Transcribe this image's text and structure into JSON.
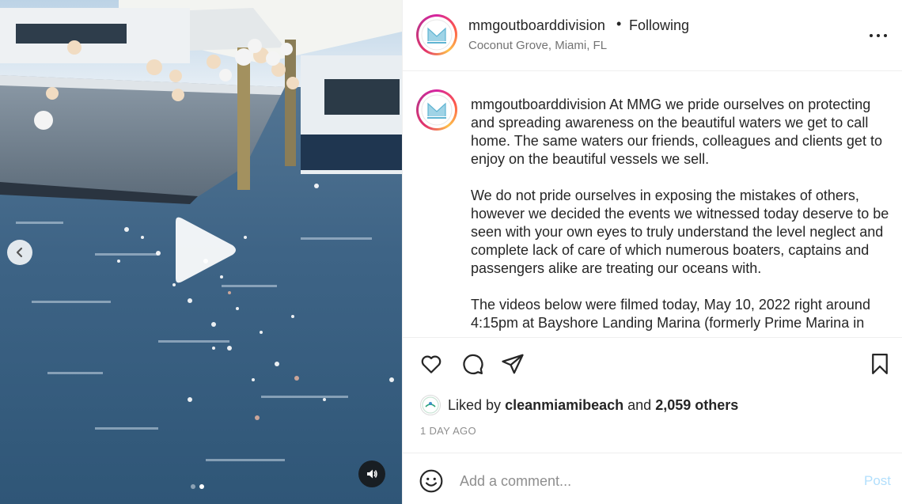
{
  "post": {
    "username": "mmgoutboarddivision",
    "separator": "•",
    "follow_status": "Following",
    "location": "Coconut Grove, Miami, FL"
  },
  "caption": {
    "username": "mmgoutboarddivision",
    "paragraph1": "At MMG we pride ourselves on protecting and spreading awareness on the beautiful waters we get to call home. The same waters our friends, colleagues and clients get to enjoy on the beautiful vessels we sell.",
    "paragraph2": "We do not pride ourselves in exposing the mistakes of others, however we decided the events we witnessed today deserve to be seen with your own eyes to truly understand the level neglect and complete lack of care of which numerous boaters, captains and passengers alike are treating our oceans with.",
    "paragraph3": "The videos below were filmed today, May 10, 2022 right around 4:15pm at Bayshore Landing Marina (formerly Prime Marina in"
  },
  "likes": {
    "prefix": "Liked by",
    "liker": "cleanmiamibeach",
    "conjunction": "and",
    "others": "2,059 others"
  },
  "timestamp": "1 DAY AGO",
  "comment": {
    "placeholder": "Add a comment...",
    "post_label": "Post"
  },
  "media": {
    "slide_count": 2,
    "active_slide": 2
  },
  "icons": {
    "like": "heart-icon",
    "comment": "comment-icon",
    "share": "paper-plane-icon",
    "save": "bookmark-icon",
    "more": "more-options-icon",
    "emoji": "emoji-icon",
    "play": "play-icon",
    "prev": "chevron-left-icon",
    "audio": "speaker-icon"
  },
  "colors": {
    "post_disabled": "#b2dffc",
    "secondary_text": "#8e8e8e",
    "primary_text": "#262626"
  }
}
